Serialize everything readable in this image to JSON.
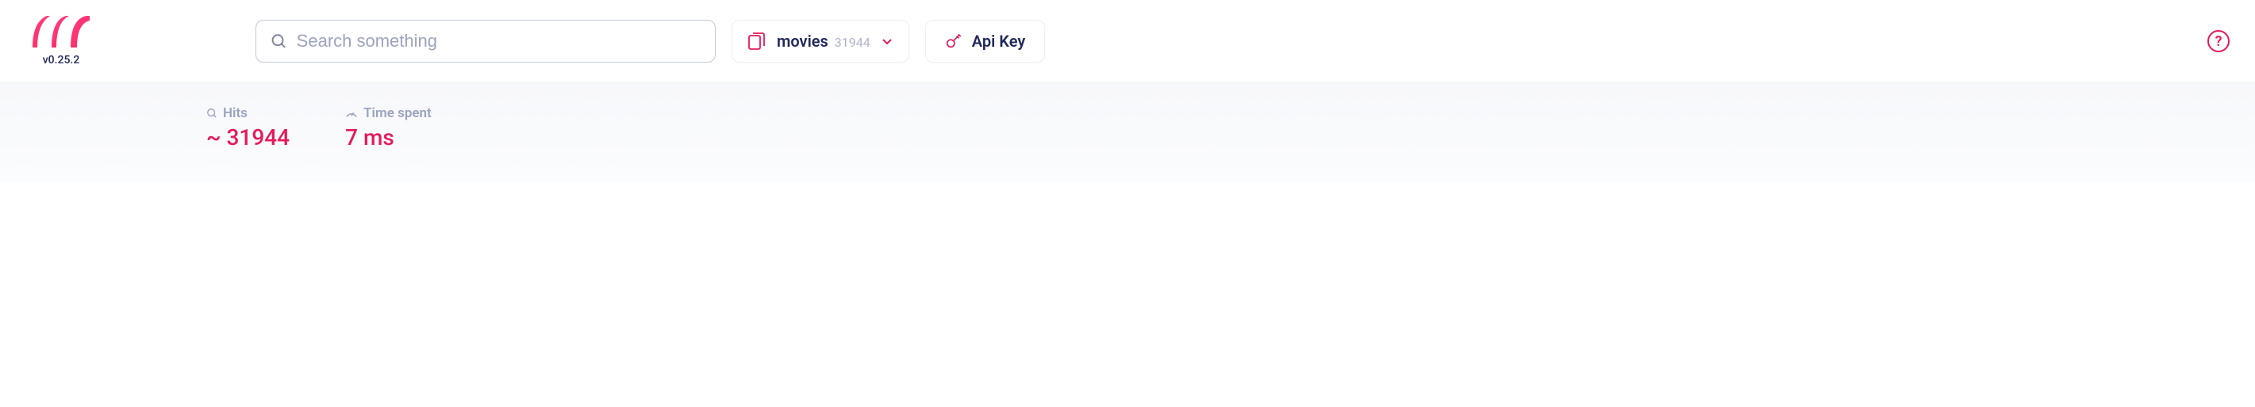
{
  "app": {
    "version": "v0.25.2"
  },
  "search": {
    "placeholder": "Search something",
    "value": ""
  },
  "index": {
    "name": "movies",
    "count": "31944"
  },
  "apiKey": {
    "label": "Api Key"
  },
  "help": {
    "symbol": "?"
  },
  "stats": {
    "hits": {
      "label": "Hits",
      "value": "~ 31944"
    },
    "time": {
      "label": "Time spent",
      "value": "7 ms"
    }
  },
  "colors": {
    "accent": "#e6195b",
    "accentLight": "#fd5e84",
    "text": "#21295c",
    "muted": "#9ba3bf"
  }
}
